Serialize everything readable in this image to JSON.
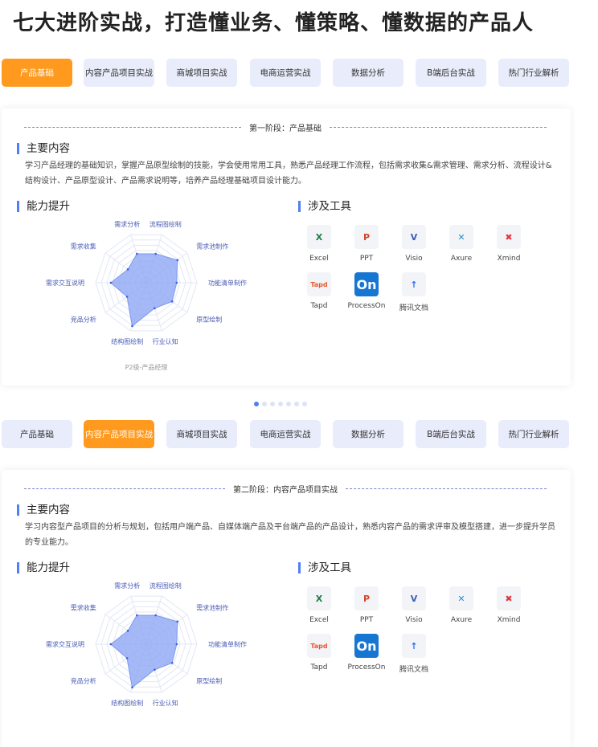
{
  "title": "七大进阶实战，打造懂业务、懂策略、懂数据的产品人",
  "tabs": [
    "产品基础",
    "内容产品项目实战",
    "商城项目实战",
    "电商运营实战",
    "数据分析",
    "B端后台实战",
    "热门行业解析"
  ],
  "colors": {
    "accent": "#ff9a1f",
    "tab_bg": "#e8ecfb",
    "heading_bar": "#4f7ef7",
    "radar_fill": "#8fa8f5"
  },
  "carousel": {
    "count": 7,
    "active_index": 0
  },
  "sections": [
    {
      "active_tab": 0,
      "stage": "第一阶段：产品基础",
      "content_heading": "主要内容",
      "content": "学习产品经理的基础知识，掌握产品原型绘制的技能，学会使用常用工具，熟悉产品经理工作流程，包括需求收集&需求管理、需求分析、流程设计&结构设计、产品原型设计、产品需求说明等，培养产品经理基础项目设计能力。",
      "ability_heading": "能力提升",
      "tools_heading": "涉及工具",
      "chart_data": {
        "type": "radar",
        "axes": [
          "需求分析",
          "流程图绘制",
          "需求池制作",
          "功能清单制作",
          "原型绘制",
          "行业认知",
          "结构图绘制",
          "竞品分析",
          "需求交互说明",
          "需求收集"
        ],
        "values": [
          6,
          6,
          7.6,
          6,
          6.3,
          5.3,
          9,
          4.7,
          7,
          4.5
        ],
        "max": 10,
        "caption": "P2级-产品经理"
      },
      "tools": [
        {
          "name": "Excel",
          "icon": "excel-icon"
        },
        {
          "name": "PPT",
          "icon": "powerpoint-icon"
        },
        {
          "name": "Visio",
          "icon": "visio-icon"
        },
        {
          "name": "Axure",
          "icon": "axure-icon"
        },
        {
          "name": "Xmind",
          "icon": "xmind-icon"
        },
        {
          "name": "Tapd",
          "icon": "tapd-icon"
        },
        {
          "name": "ProcessOn",
          "icon": "processon-icon"
        },
        {
          "name": "腾讯文档",
          "icon": "tencent-docs-icon"
        }
      ]
    },
    {
      "active_tab": 1,
      "stage": "第二阶段：内容产品项目实战",
      "content_heading": "主要内容",
      "content": "学习内容型产品项目的分析与规划，包括用户端产品、自媒体端产品及平台端产品的产品设计，熟悉内容产品的需求评审及模型搭建，进一步提升学员的专业能力。",
      "ability_heading": "能力提升",
      "tools_heading": "涉及工具",
      "chart_data": {
        "type": "radar",
        "axes": [
          "需求分析",
          "流程图绘制",
          "需求池制作",
          "功能清单制作",
          "原型绘制",
          "行业认知",
          "结构图绘制",
          "竞品分析",
          "需求交互说明",
          "需求收集"
        ],
        "values": [
          6,
          6,
          7.6,
          6,
          6.3,
          5.3,
          9,
          4.7,
          7,
          4.5
        ],
        "max": 10
      },
      "tools": [
        {
          "name": "Excel",
          "icon": "excel-icon"
        },
        {
          "name": "PPT",
          "icon": "powerpoint-icon"
        },
        {
          "name": "Visio",
          "icon": "visio-icon"
        },
        {
          "name": "Axure",
          "icon": "axure-icon"
        },
        {
          "name": "Xmind",
          "icon": "xmind-icon"
        },
        {
          "name": "Tapd",
          "icon": "tapd-icon"
        },
        {
          "name": "ProcessOn",
          "icon": "processon-icon"
        },
        {
          "name": "腾讯文档",
          "icon": "tencent-docs-icon"
        }
      ]
    }
  ]
}
